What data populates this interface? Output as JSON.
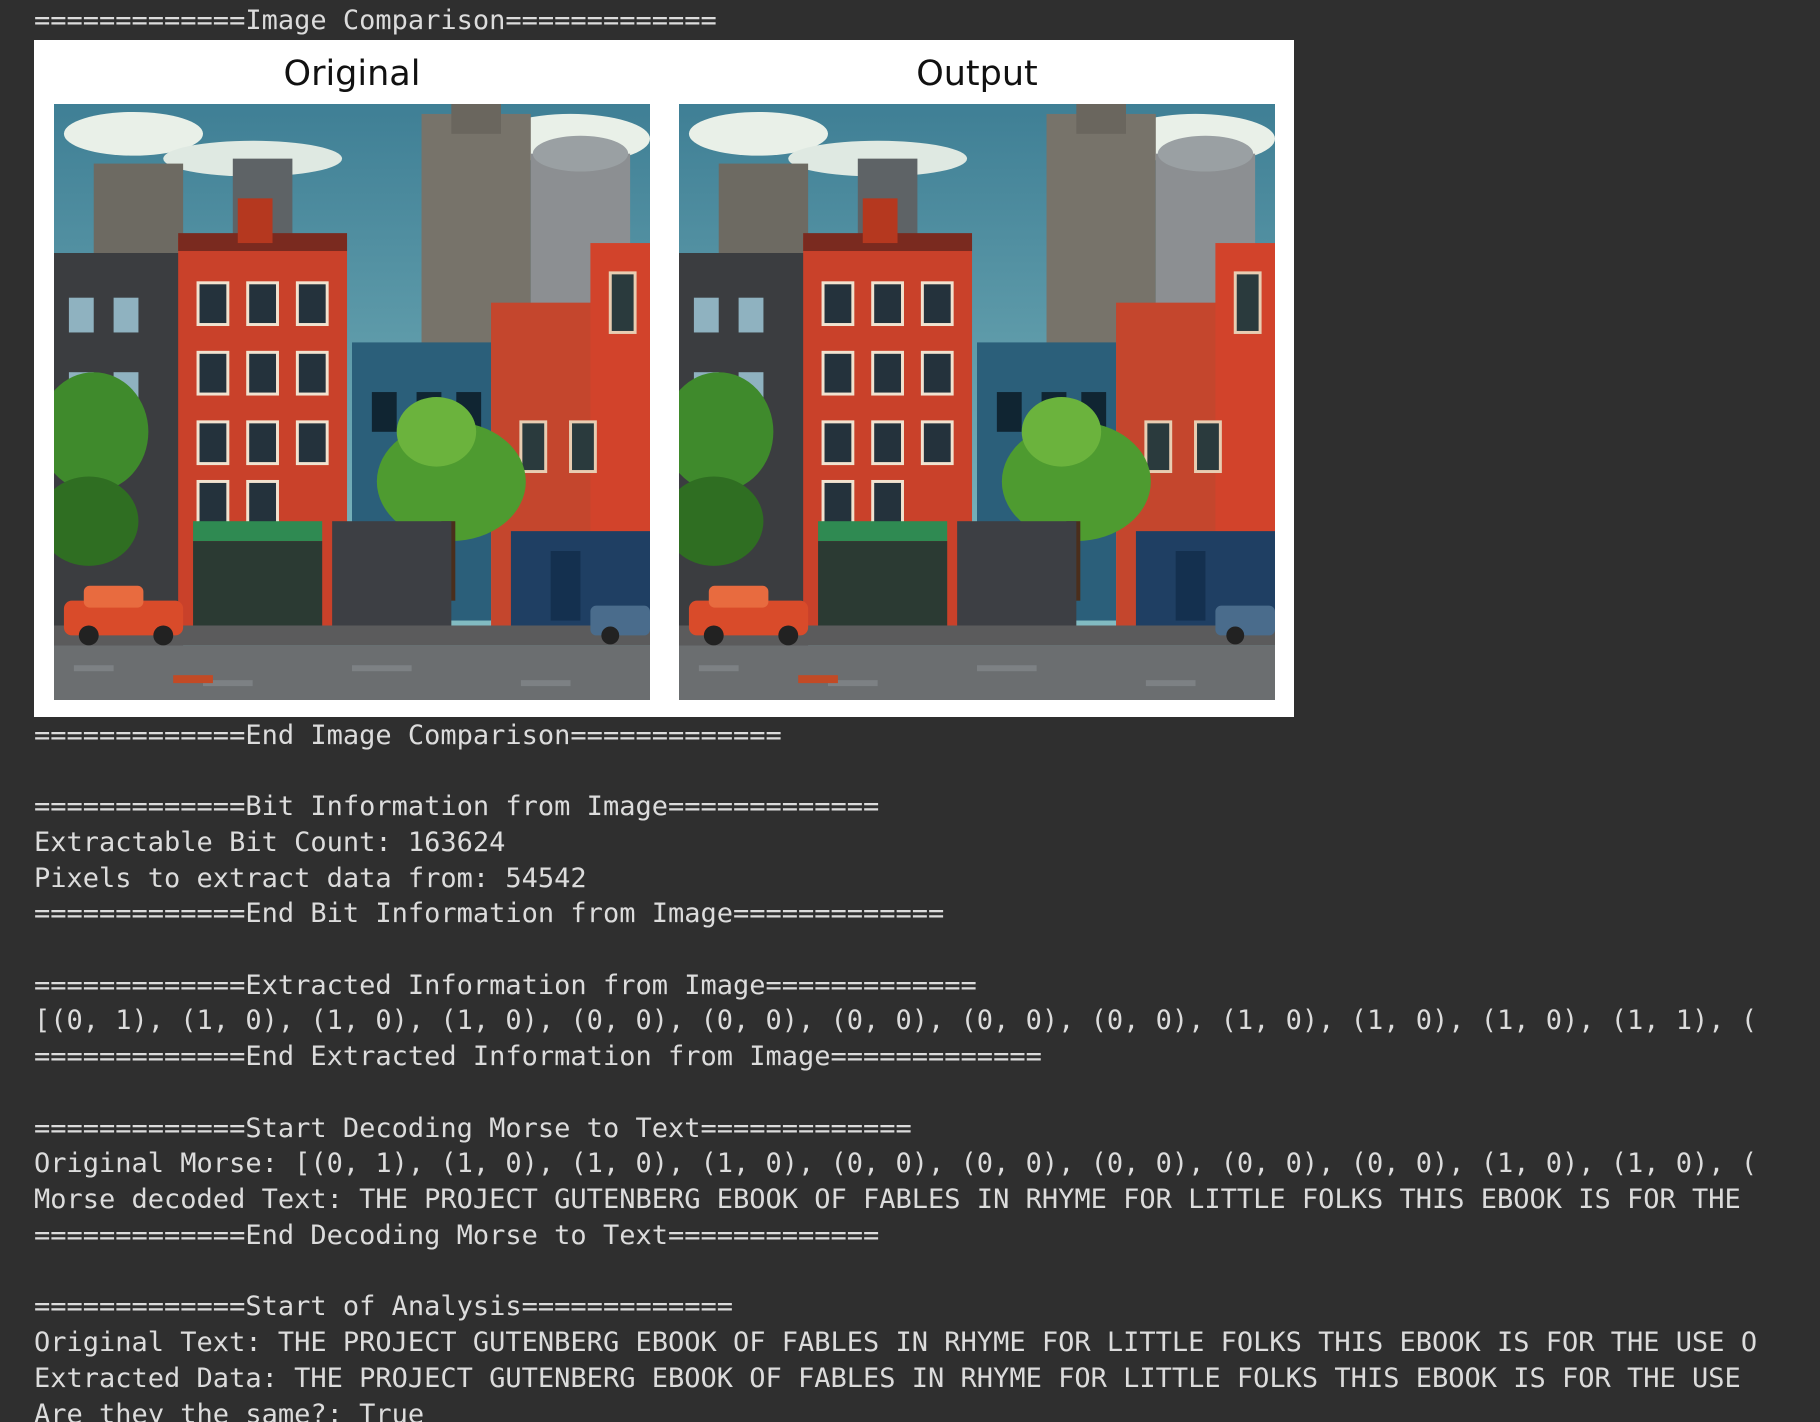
{
  "output": {
    "header_compare": "=============Image Comparison=============",
    "figure": {
      "left_title": "Original",
      "right_title": "Output"
    },
    "footer_compare": "=============End Image Comparison=============",
    "bit_header": "=============Bit Information from Image=============",
    "bit_count": "Extractable Bit Count: 163624",
    "pixels": "Pixels to extract data from: 54542",
    "bit_footer": "=============End Bit Information from Image=============",
    "extracted_header": "=============Extracted Information from Image=============",
    "extracted_values": "[(0, 1), (1, 0), (1, 0), (1, 0), (0, 0), (0, 0), (0, 0), (0, 0), (0, 0), (1, 0), (1, 0), (1, 0), (1, 1), (",
    "extracted_footer": "=============End Extracted Information from Image=============",
    "decode_header": "=============Start Decoding Morse to Text=============",
    "original_morse": "Original Morse: [(0, 1), (1, 0), (1, 0), (1, 0), (0, 0), (0, 0), (0, 0), (0, 0), (0, 0), (1, 0), (1, 0), (",
    "decoded_text": "Morse decoded Text: THE PROJECT GUTENBERG EBOOK OF FABLES IN RHYME FOR LITTLE FOLKS THIS EBOOK IS FOR THE",
    "decode_footer": "=============End Decoding Morse to Text=============",
    "analysis_header": "=============Start of Analysis=============",
    "original_text": "Original Text: THE PROJECT GUTENBERG EBOOK OF FABLES IN RHYME FOR LITTLE FOLKS THIS EBOOK IS FOR THE USE O",
    "extracted_data": "Extracted Data: THE PROJECT GUTENBERG EBOOK OF FABLES IN RHYME FOR LITTLE FOLKS THIS EBOOK IS FOR THE USE",
    "same_check": "Are they the same?: True"
  },
  "colors": {
    "background": "#2f2f2f",
    "text": "#dcdcdc",
    "figure_bg": "#ffffff"
  }
}
